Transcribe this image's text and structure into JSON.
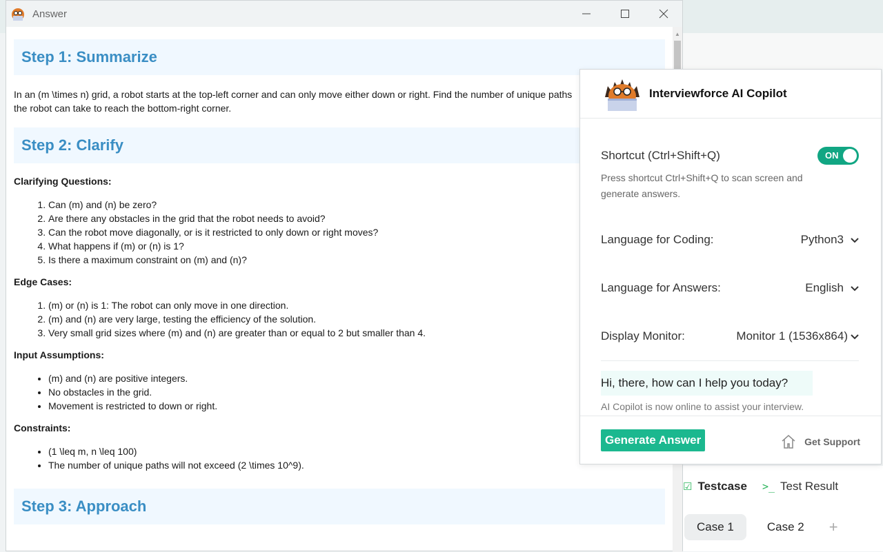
{
  "window": {
    "title": "Answer",
    "minimize_icon": "minimize-icon",
    "maximize_icon": "maximize-icon",
    "close_icon": "close-icon"
  },
  "answer": {
    "step1_title": "Step 1: Summarize",
    "summary": "In an (m \\times n) grid, a robot starts at the top-left corner and can only move either down or right. Find the number of unique paths the robot can take to reach the bottom-right corner.",
    "step2_title": "Step 2: Clarify",
    "clarifying_heading": "Clarifying Questions:",
    "clarifying_questions": [
      "Can (m) and (n) be zero?",
      "Are there any obstacles in the grid that the robot needs to avoid?",
      "Can the robot move diagonally, or is it restricted to only down or right moves?",
      "What happens if (m) or (n) is 1?",
      "Is there a maximum constraint on (m) and (n)?"
    ],
    "edge_heading": "Edge Cases:",
    "edge_cases": [
      "(m) or (n) is 1: The robot can only move in one direction.",
      "(m) and (n) are very large, testing the efficiency of the solution.",
      "Very small grid sizes where (m) and (n) are greater than or equal to 2 but smaller than 4."
    ],
    "input_heading": "Input Assumptions:",
    "input_assumptions": [
      "(m) and (n) are positive integers.",
      "No obstacles in the grid.",
      "Movement is restricted to down or right."
    ],
    "constraints_heading": "Constraints:",
    "constraints": [
      "(1 \\leq m, n \\leq 100)",
      "The number of unique paths will not exceed (2 \\times 10^9)."
    ],
    "step3_title": "Step 3: Approach"
  },
  "copilot": {
    "title": "Interviewforce AI Copilot",
    "shortcut_label": "Shortcut (Ctrl+Shift+Q)",
    "toggle_label": "ON",
    "shortcut_desc": "Press shortcut Ctrl+Shift+Q to scan screen and generate answers.",
    "coding_lang_label": "Language for Coding:",
    "coding_lang_value": "Python3",
    "answer_lang_label": "Language for Answers:",
    "answer_lang_value": "English",
    "monitor_label": "Display Monitor:",
    "monitor_value": "Monitor 1 (1536x864)",
    "greeting": "Hi, there, how can I help you today?",
    "online_msg": "AI Copilot is now online to assist your interview.",
    "generate_button": "Generate Answer",
    "support_label": "Get Support"
  },
  "background": {
    "tab_testcase": "Testcase",
    "tab_test_result": "Test Result",
    "case1": "Case 1",
    "case2": "Case 2",
    "add_case": "+"
  },
  "colors": {
    "accent": "#1bb88f",
    "heading_blue": "#3a8ec4",
    "heading_bg": "#f0f8ff"
  }
}
